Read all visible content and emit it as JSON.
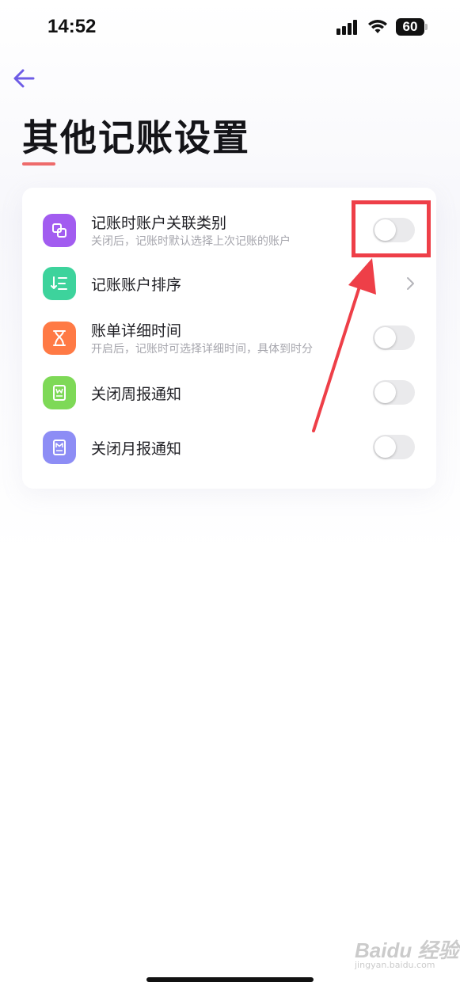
{
  "status_bar": {
    "time": "14:52",
    "battery": "60",
    "icons": [
      "signal-icon",
      "wifi-icon",
      "battery-icon"
    ]
  },
  "header": {
    "back_icon": "arrow-left-icon",
    "title": "其他记账设置"
  },
  "colors": {
    "accent": "#6e5ce6",
    "title_underline": "#ee6b6b",
    "annotation_red": "#ee3f48",
    "toggle_off": "#eaeaec",
    "icon_purple": "#a25cf0",
    "icon_teal": "#3dd39c",
    "icon_orange": "#ff7a45",
    "icon_green": "#7ed957",
    "icon_lavender": "#8d8df5"
  },
  "settings": {
    "items": [
      {
        "icon": "link-squares-icon",
        "title": "记账时账户关联类别",
        "subtitle": "关闭后，记账时默认选择上次记账的账户",
        "control": "toggle",
        "enabled": false
      },
      {
        "icon": "sort-list-icon",
        "title": "记账账户排序",
        "subtitle": "",
        "control": "chevron"
      },
      {
        "icon": "hourglass-icon",
        "title": "账单详细时间",
        "subtitle": "开启后，记账时可选择详细时间，具体到时分",
        "control": "toggle",
        "enabled": false
      },
      {
        "icon": "weekly-report-icon",
        "title": "关闭周报通知",
        "subtitle": "",
        "control": "toggle",
        "enabled": false
      },
      {
        "icon": "monthly-report-icon",
        "title": "关闭月报通知",
        "subtitle": "",
        "control": "toggle",
        "enabled": false
      }
    ]
  },
  "watermark": {
    "logo": "Baidu 经验",
    "url": "jingyan.baidu.com"
  }
}
